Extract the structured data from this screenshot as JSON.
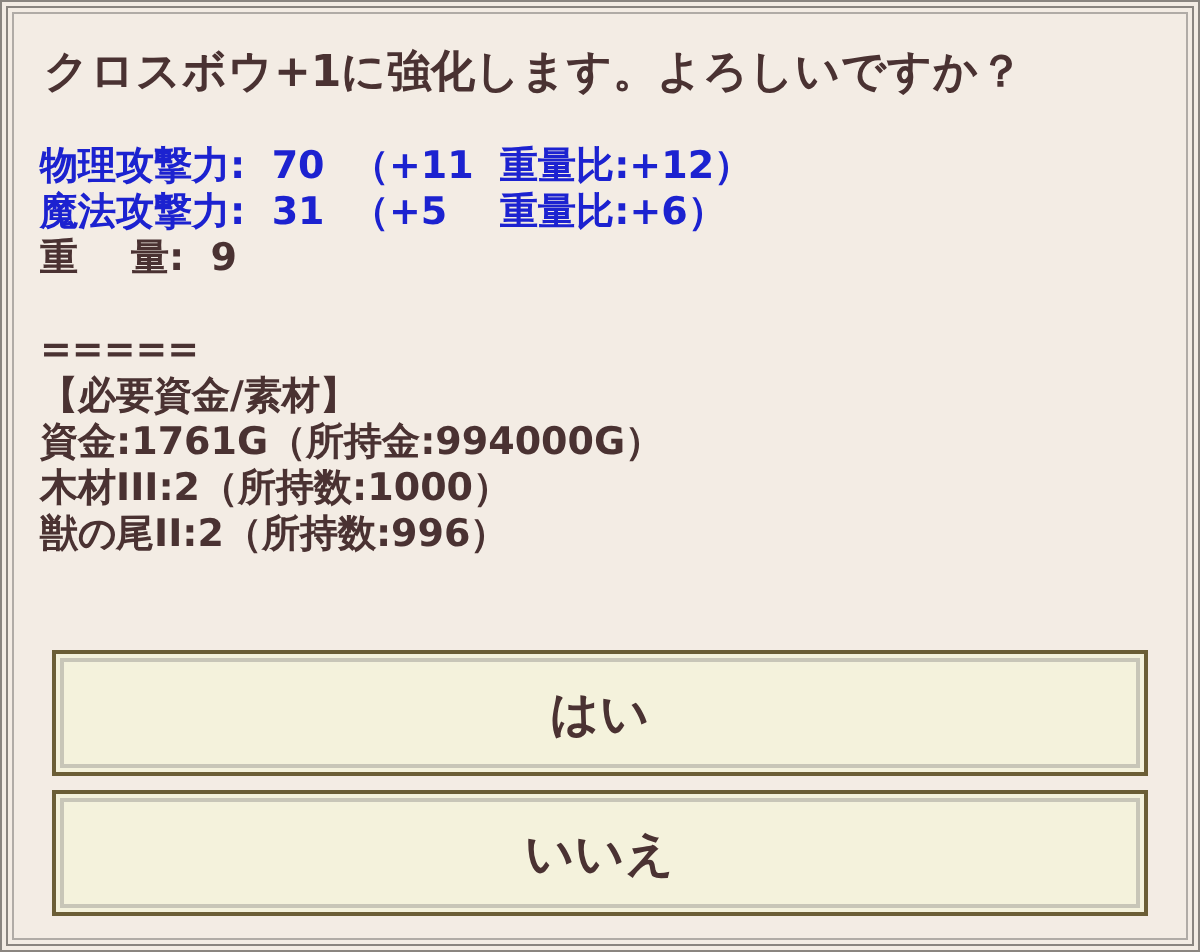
{
  "message": "クロスボウ+1に強化します。よろしいですか？",
  "stats": [
    {
      "text": "物理攻撃力:  70  （+11  重量比:+12）",
      "kind": "stat"
    },
    {
      "text": "魔法攻撃力:  31  （+5    重量比:+6）",
      "kind": "stat"
    },
    {
      "text": "重    量:  9",
      "kind": "plain"
    }
  ],
  "divider": "=====",
  "requirements": {
    "heading": "【必要資金/素材】",
    "lines": [
      "資金:1761G（所持金:994000G）",
      "木材III:2（所持数:1000）",
      "獣の尾II:2（所持数:996）"
    ]
  },
  "buttons": [
    {
      "label": "はい"
    },
    {
      "label": "いいえ"
    }
  ]
}
